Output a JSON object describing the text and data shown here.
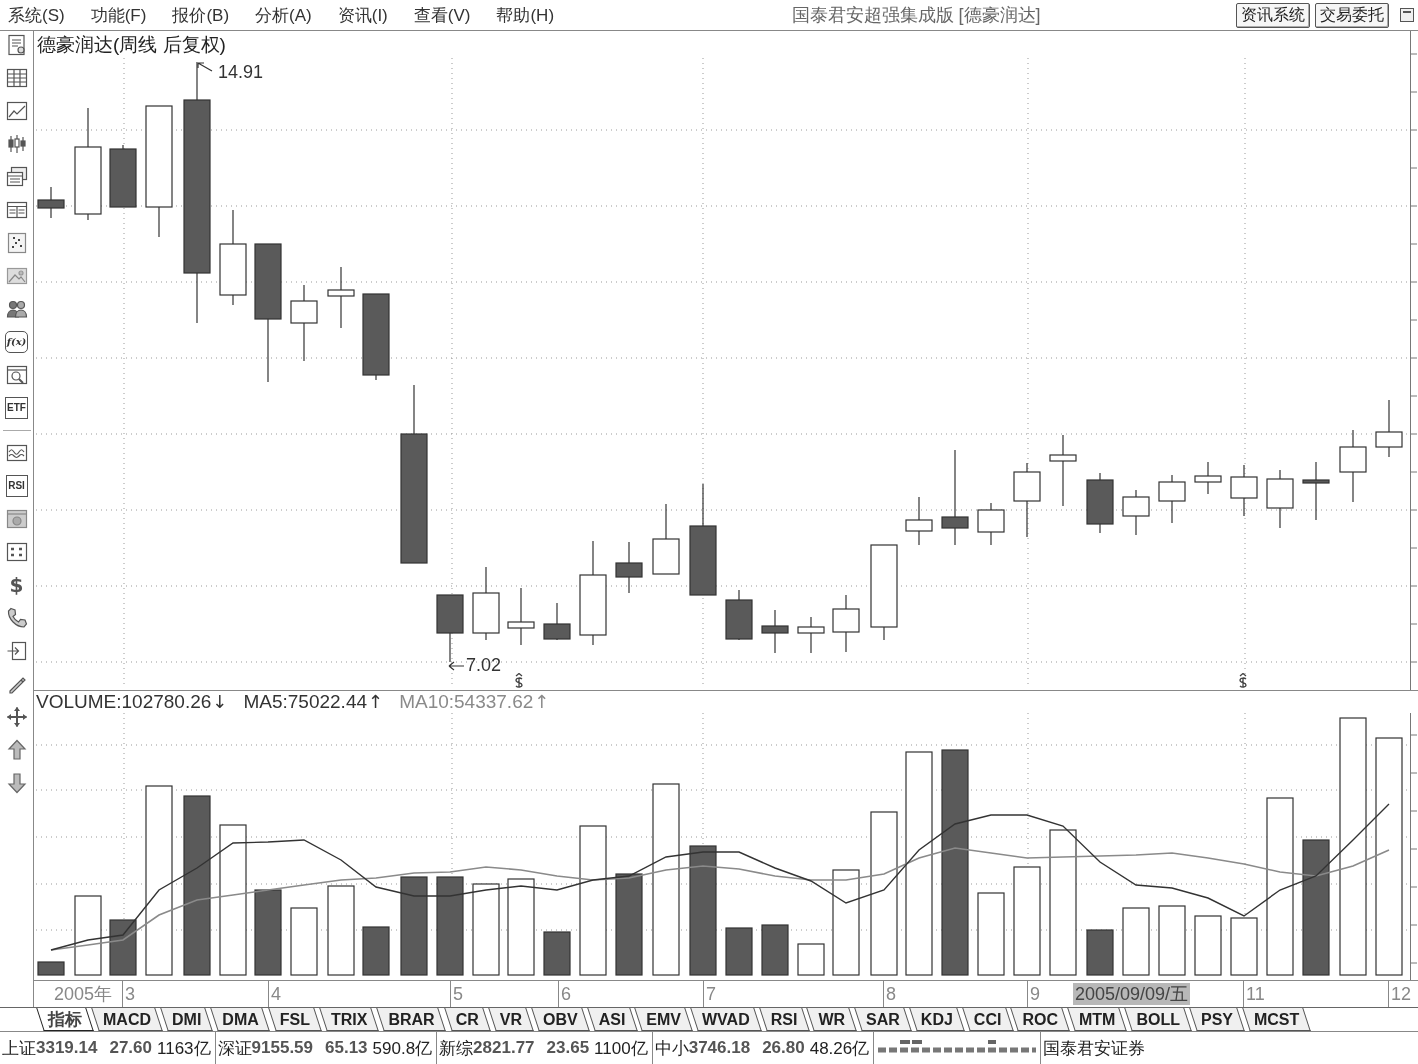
{
  "menu_bar": {
    "items": [
      "系统(S)",
      "功能(F)",
      "报价(B)",
      "分析(A)",
      "资讯(I)",
      "查看(V)",
      "帮助(H)"
    ],
    "title": "国泰君安超强集成版 [德豪润达]",
    "buttons": [
      "资讯系统",
      "交易委托"
    ]
  },
  "left_toolbar": {
    "labeled_buttons": [
      "f(x)",
      "ETF",
      "RSI",
      "$"
    ]
  },
  "price_chart": {
    "title": "德豪润达(周线 后复权)",
    "high_label": "14.91",
    "low_label": "7.02"
  },
  "volume_header": {
    "items": [
      {
        "text": "VOLUME:102780.26",
        "arrow": "↓",
        "color": "#333333"
      },
      {
        "text": "MA5:75022.44",
        "arrow": "↑",
        "color": "#333333"
      },
      {
        "text": "MA10:54337.62",
        "arrow": "↑",
        "color": "#8a8a8a"
      }
    ]
  },
  "date_axis": {
    "labels": [
      "2005年",
      "3",
      "4",
      "5",
      "6",
      "7",
      "8",
      "9",
      "11",
      "12"
    ],
    "cursor_date": "2005/09/09/五"
  },
  "indicator_tabs": {
    "items": [
      {
        "label": "指标",
        "selected": true
      },
      {
        "label": "MACD",
        "selected": false
      },
      {
        "label": "DMI",
        "selected": false
      },
      {
        "label": "DMA",
        "selected": false
      },
      {
        "label": "FSL",
        "selected": false
      },
      {
        "label": "TRIX",
        "selected": false
      },
      {
        "label": "BRAR",
        "selected": false
      },
      {
        "label": "CR",
        "selected": false
      },
      {
        "label": "VR",
        "selected": false
      },
      {
        "label": "OBV",
        "selected": false
      },
      {
        "label": "ASI",
        "selected": false
      },
      {
        "label": "EMV",
        "selected": false
      },
      {
        "label": "WVAD",
        "selected": false
      },
      {
        "label": "RSI",
        "selected": false
      },
      {
        "label": "WR",
        "selected": false
      },
      {
        "label": "SAR",
        "selected": false
      },
      {
        "label": "KDJ",
        "selected": false
      },
      {
        "label": "CCI",
        "selected": false
      },
      {
        "label": "ROC",
        "selected": false
      },
      {
        "label": "MTM",
        "selected": false
      },
      {
        "label": "BOLL",
        "selected": false
      },
      {
        "label": "PSY",
        "selected": false
      },
      {
        "label": "MCST",
        "selected": false
      }
    ]
  },
  "status_bar": {
    "indices": [
      {
        "name": "上证",
        "value": "3319.14",
        "change": "27.60",
        "turnover": "1163亿"
      },
      {
        "name": "深证",
        "value": "9155.59",
        "change": "65.13",
        "turnover": "590.8亿"
      },
      {
        "name": "新综",
        "value": "2821.77",
        "change": "23.65",
        "turnover": "1100亿"
      },
      {
        "name": "中小",
        "value": "3746.18",
        "change": "26.80",
        "turnover": "48.26亿"
      }
    ],
    "broker": "国泰君安证券"
  }
}
